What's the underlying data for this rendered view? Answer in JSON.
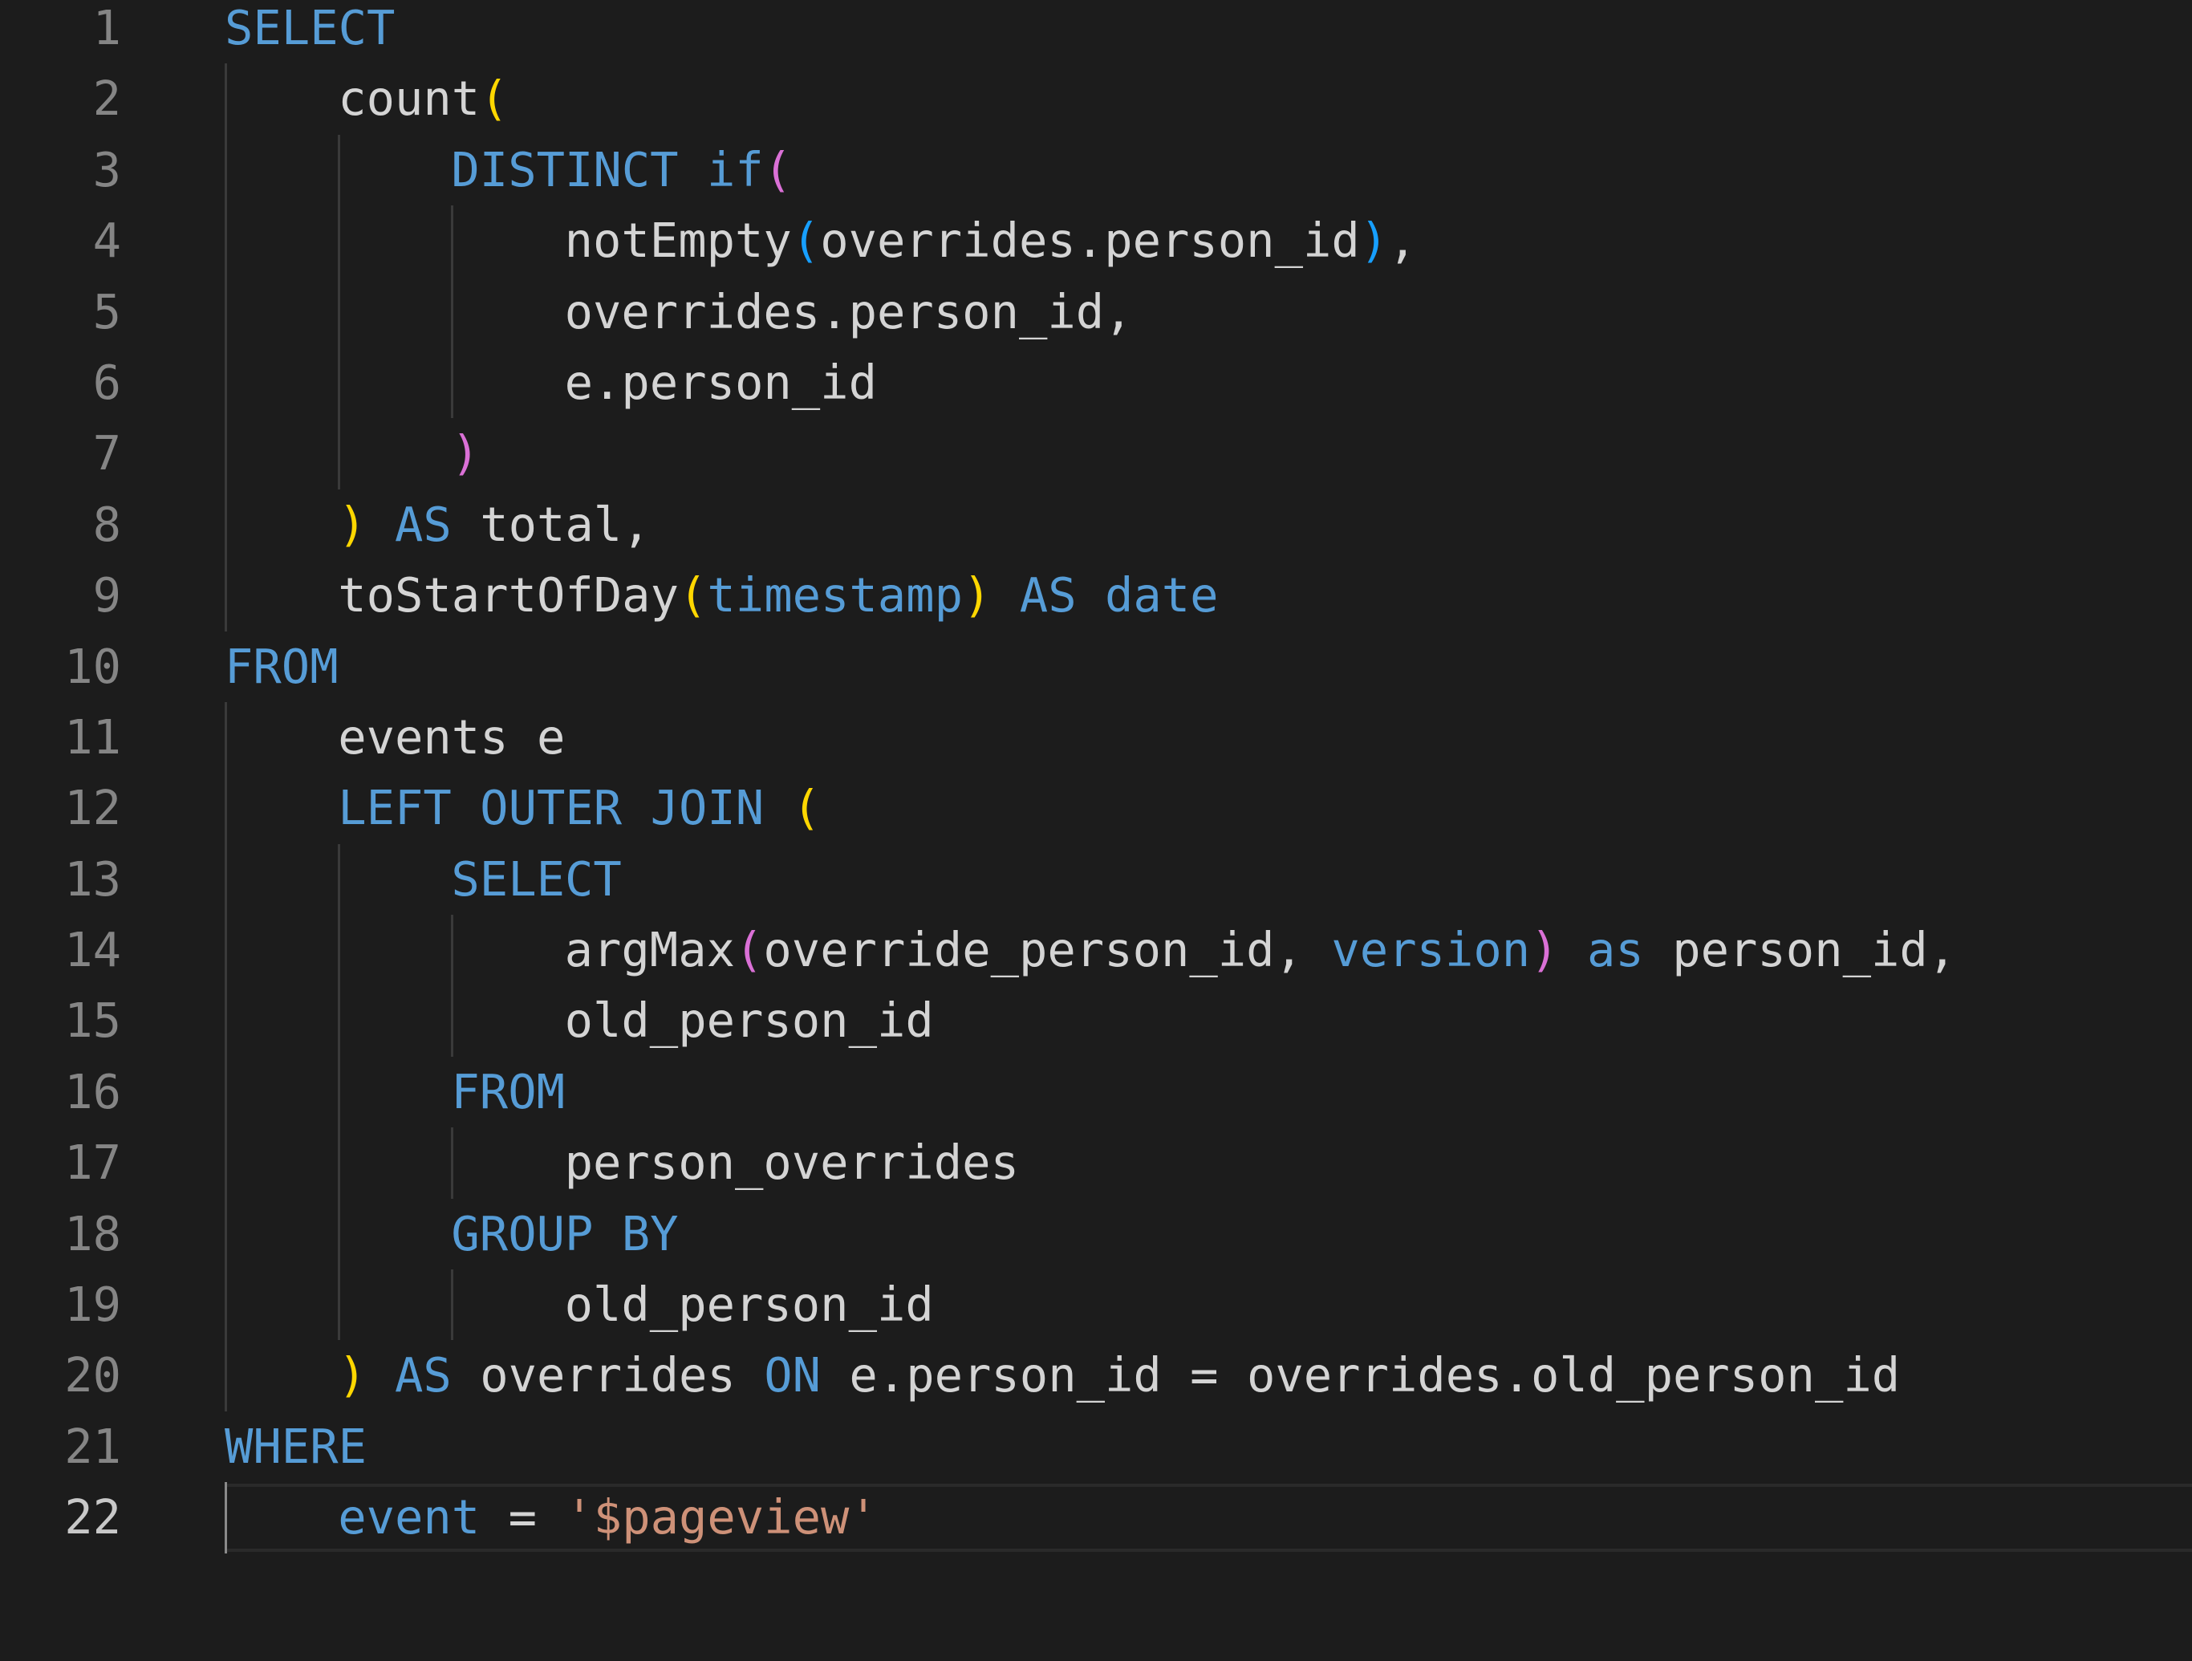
{
  "editor": {
    "active_line": 22,
    "lines": [
      {
        "n": "1",
        "indent": 0,
        "tokens": [
          [
            "SELECT",
            "kw"
          ]
        ]
      },
      {
        "n": "2",
        "indent": 1,
        "tokens": [
          [
            "count",
            "tx"
          ],
          [
            "(",
            "b1"
          ]
        ]
      },
      {
        "n": "3",
        "indent": 2,
        "tokens": [
          [
            "DISTINCT if",
            "kw"
          ],
          [
            "(",
            "b2"
          ]
        ]
      },
      {
        "n": "4",
        "indent": 3,
        "tokens": [
          [
            "notEmpty",
            "tx"
          ],
          [
            "(",
            "b3"
          ],
          [
            "overrides.person_id",
            "tx"
          ],
          [
            ")",
            "b3"
          ],
          [
            ",",
            "tx"
          ]
        ]
      },
      {
        "n": "5",
        "indent": 3,
        "tokens": [
          [
            "overrides.person_id,",
            "tx"
          ]
        ]
      },
      {
        "n": "6",
        "indent": 3,
        "tokens": [
          [
            "e.person_id",
            "tx"
          ]
        ]
      },
      {
        "n": "7",
        "indent": 2,
        "tokens": [
          [
            ")",
            "b2"
          ]
        ]
      },
      {
        "n": "8",
        "indent": 1,
        "tokens": [
          [
            ")",
            "b1"
          ],
          [
            " AS",
            "kw"
          ],
          [
            " total,",
            "tx"
          ]
        ]
      },
      {
        "n": "9",
        "indent": 1,
        "tokens": [
          [
            "toStartOfDay",
            "tx"
          ],
          [
            "(",
            "b1"
          ],
          [
            "timestamp",
            "kw"
          ],
          [
            ")",
            "b1"
          ],
          [
            " AS date",
            "kw"
          ]
        ]
      },
      {
        "n": "10",
        "indent": 0,
        "tokens": [
          [
            "FROM",
            "kw"
          ]
        ]
      },
      {
        "n": "11",
        "indent": 1,
        "tokens": [
          [
            "events e",
            "tx"
          ]
        ]
      },
      {
        "n": "12",
        "indent": 1,
        "tokens": [
          [
            "LEFT OUTER JOIN ",
            "kw"
          ],
          [
            "(",
            "b1"
          ]
        ]
      },
      {
        "n": "13",
        "indent": 2,
        "tokens": [
          [
            "SELECT",
            "kw"
          ]
        ]
      },
      {
        "n": "14",
        "indent": 3,
        "tokens": [
          [
            "argMax",
            "tx"
          ],
          [
            "(",
            "b2"
          ],
          [
            "override_person_id, ",
            "tx"
          ],
          [
            "version",
            "kw"
          ],
          [
            ")",
            "b2"
          ],
          [
            " as",
            "kw"
          ],
          [
            " person_id,",
            "tx"
          ]
        ]
      },
      {
        "n": "15",
        "indent": 3,
        "tokens": [
          [
            "old_person_id",
            "tx"
          ]
        ]
      },
      {
        "n": "16",
        "indent": 2,
        "tokens": [
          [
            "FROM",
            "kw"
          ]
        ]
      },
      {
        "n": "17",
        "indent": 3,
        "tokens": [
          [
            "person_overrides",
            "tx"
          ]
        ]
      },
      {
        "n": "18",
        "indent": 2,
        "tokens": [
          [
            "GROUP BY",
            "kw"
          ]
        ]
      },
      {
        "n": "19",
        "indent": 3,
        "tokens": [
          [
            "old_person_id",
            "tx"
          ]
        ]
      },
      {
        "n": "20",
        "indent": 1,
        "tokens": [
          [
            ")",
            "b1"
          ],
          [
            " AS",
            "kw"
          ],
          [
            " overrides ",
            "tx"
          ],
          [
            "ON",
            "kw"
          ],
          [
            " e.person_id = overrides.old_person_id",
            "tx"
          ]
        ]
      },
      {
        "n": "21",
        "indent": 0,
        "tokens": [
          [
            "WHERE",
            "kw"
          ]
        ]
      },
      {
        "n": "22",
        "indent": 1,
        "tokens": [
          [
            "event",
            "kw"
          ],
          [
            " = ",
            "tx"
          ],
          [
            "'$pageview'",
            "str"
          ]
        ]
      }
    ]
  }
}
